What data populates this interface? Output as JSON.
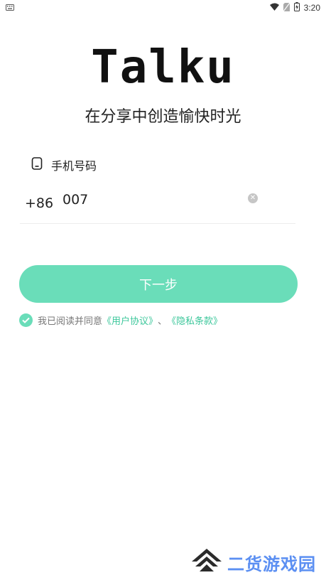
{
  "status": {
    "time": "3:20"
  },
  "logo_text": "Talku",
  "slogan": "在分享中创造愉快时光",
  "phone": {
    "label": "手机号码",
    "country_code": "+86",
    "value": "007",
    "icon": "phone-icon",
    "clear_icon": "clear-icon"
  },
  "next_button": {
    "label": "下一步",
    "color": "#6addb9"
  },
  "agreement": {
    "checked": true,
    "prefix": "我已阅读并同意",
    "user_agreement": "《用户协议》",
    "separator": "、",
    "privacy_policy": "《隐私条款》",
    "link_color": "#3cc79b"
  },
  "watermark": {
    "text": "二货游戏园"
  }
}
